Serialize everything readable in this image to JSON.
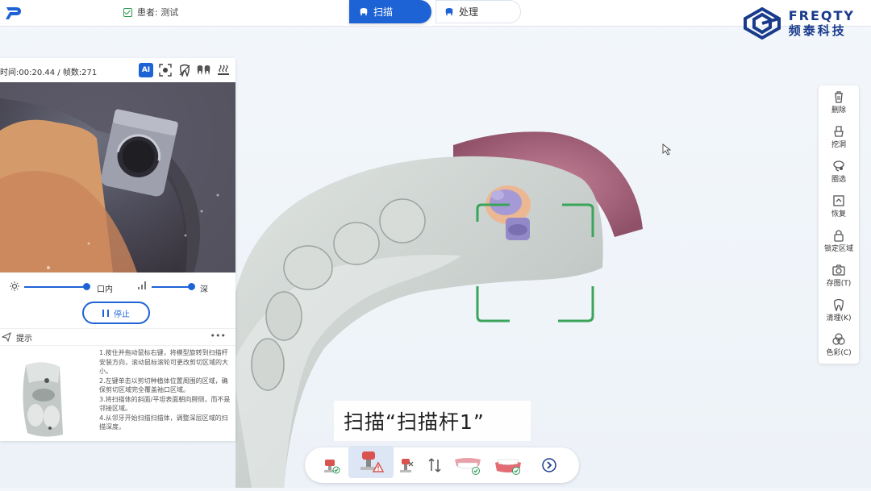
{
  "app": {
    "patient_label": "患者: 测试"
  },
  "tabs": [
    {
      "label": "扫描",
      "active": true
    },
    {
      "label": "处理",
      "active": false
    }
  ],
  "brand": {
    "name": "FREQTY",
    "cn_name": "频泰科技",
    "color": "#1a3b8c"
  },
  "scan_panel": {
    "status_text": "时间:00:20.44 / 帧数:271",
    "icons": [
      "ai-icon",
      "capture-icon",
      "tooth-scan-icon",
      "dual-tooth-icon",
      "heat-icon"
    ],
    "ai_label": "AI",
    "brightness_label": "口内",
    "brightness_value": 1.0,
    "depth_label": "深",
    "depth_value": 1.0,
    "stop_label": "停止"
  },
  "hint": {
    "title": "提示",
    "more": "•••",
    "lines": [
      "1.按住并拖动鼠标右键，将模型旋转到扫描杆安装方向，滚动鼠标滚轮可更改剪切区域的大小。",
      "2.左键单击以剪切种植体位置周围的区域，确保剪切区域完全覆盖袖口区域。",
      "3.将扫描体的斜面/平坦表面朝向腭侧，而不是邻接区域。",
      "4.从邻牙开始扫描扫描体，调整深层区域的扫描深度。"
    ]
  },
  "toolbar": [
    {
      "label": "删除",
      "icon": "trash-icon"
    },
    {
      "label": "挖洞",
      "icon": "dig-hole-icon"
    },
    {
      "label": "圈选",
      "icon": "lasso-icon"
    },
    {
      "label": "恢复",
      "icon": "restore-icon"
    },
    {
      "label": "锁定区域",
      "icon": "lock-icon"
    },
    {
      "label": "存图(T)",
      "icon": "camera-icon"
    },
    {
      "label": "清理(K)",
      "icon": "clean-icon"
    },
    {
      "label": "色彩(C)",
      "icon": "color-icon"
    }
  ],
  "caption": "扫描“扫描杆1”",
  "bottom_bar": [
    {
      "name": "scanbody-done",
      "icon": "scanbody-check-icon"
    },
    {
      "name": "scanbody-warning",
      "icon": "scanbody-warning-icon",
      "active": true
    },
    {
      "name": "scanbody-cut",
      "icon": "scanbody-cut-icon"
    },
    {
      "name": "bite-swap",
      "icon": "swap-arrows-icon"
    },
    {
      "name": "upper-jaw",
      "icon": "upper-jaw-check-icon"
    },
    {
      "name": "lower-jaw",
      "icon": "lower-jaw-check-icon"
    },
    {
      "name": "next",
      "icon": "chevron-right-icon"
    }
  ],
  "colors": {
    "accent": "#1e63d6",
    "focus_frame": "#3aa45a",
    "model_gray": "#cdd3d0",
    "gum_pink": "#b06f86",
    "scanbody_purple": "#a59ad6"
  }
}
